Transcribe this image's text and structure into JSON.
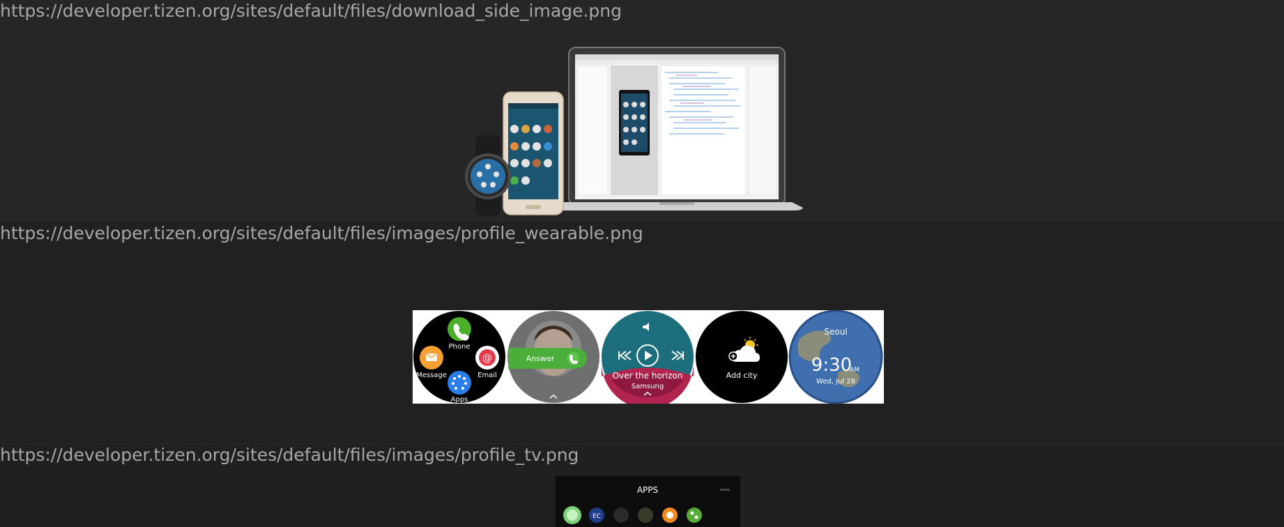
{
  "images": [
    {
      "url": "https://developer.tizen.org/sites/default/files/download_side_image.png"
    },
    {
      "url": "https://developer.tizen.org/sites/default/files/images/profile_wearable.png",
      "watch_labels": {
        "phone": "Phone",
        "message": "Message",
        "email": "Email",
        "apps": "Apps",
        "answer": "Answer",
        "song_title": "Over the horizon",
        "song_artist": "Samsung",
        "add_city": "Add city",
        "city": "Seoul",
        "time": "9:30",
        "ampm": "AM",
        "date": "Wed, Jul 28"
      }
    },
    {
      "url": "https://developer.tizen.org/sites/default/files/images/profile_tv.png",
      "tv_title": "APPS"
    }
  ]
}
